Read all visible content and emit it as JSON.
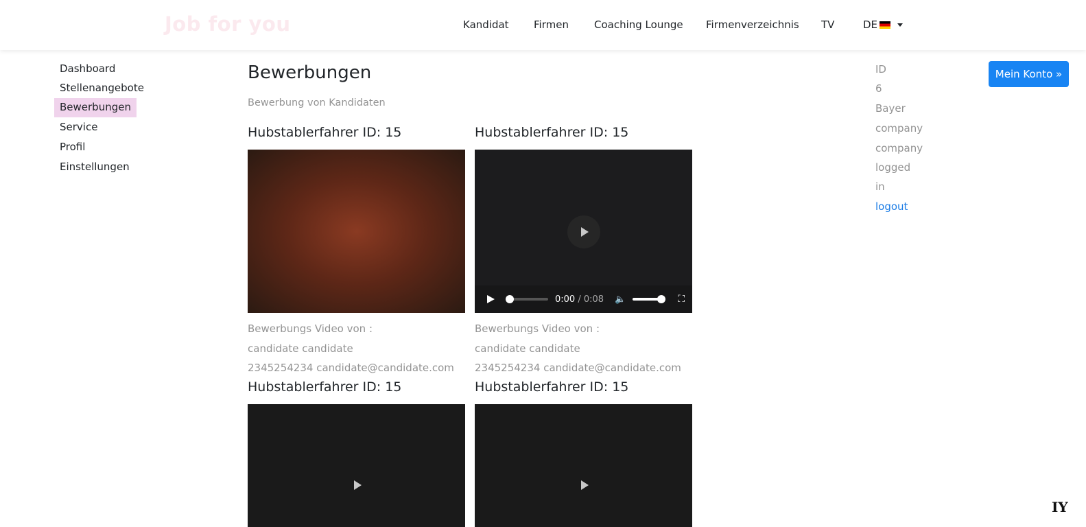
{
  "brand": "Job for you",
  "nav": {
    "items": [
      "Kandidat",
      "Firmen",
      "Coaching Lounge",
      "Firmenverzeichnis",
      "TV"
    ],
    "lang": "DE"
  },
  "sidebar": {
    "items": [
      "Dashboard",
      "Stellenangebote",
      "Bewerbungen",
      "Service",
      "Profil",
      "Einstellungen"
    ],
    "active": "Bewerbungen"
  },
  "main": {
    "title": "Bewerbungen",
    "subtitle": "Bewerbung von Kandidaten",
    "cards": [
      {
        "title": "Hubstablerfahrer ID: 15",
        "meta_label": "Bewerbungs Video von :",
        "name": "candidate candidate",
        "contact": "2345254234 candidate@candidate.com"
      },
      {
        "title": "Hubstablerfahrer ID: 15",
        "meta_label": "Bewerbungs Video von :",
        "name": "candidate candidate",
        "contact": "2345254234 candidate@candidate.com",
        "player": {
          "current": "0:00",
          "duration": "/ 0:08"
        }
      },
      {
        "title": "Hubstablerfahrer ID: 15"
      },
      {
        "title": "Hubstablerfahrer ID: 15"
      }
    ]
  },
  "info": {
    "lines": [
      "ID",
      "6",
      "Bayer",
      "company",
      "company",
      "logged",
      "in"
    ],
    "logout": "logout"
  },
  "account_button": "Mein Konto »",
  "corner_logo": "IY"
}
